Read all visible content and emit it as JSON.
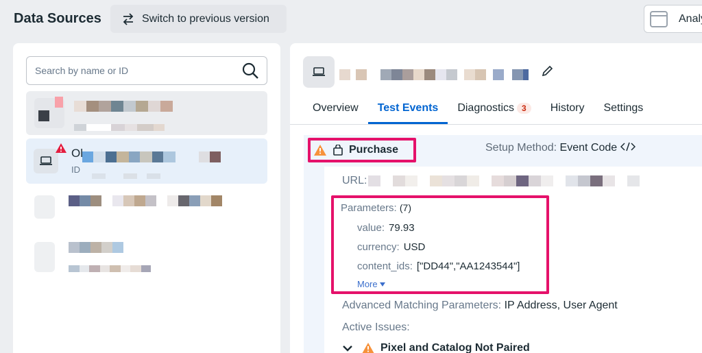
{
  "header": {
    "title": "Data Sources",
    "switch_label": "Switch to previous version",
    "analytics_label": "Analy"
  },
  "search": {
    "placeholder": "Search by name or ID"
  },
  "sources": {
    "selected_name_prefix": "Ol",
    "selected_id_prefix": "ID"
  },
  "detail": {
    "tabs": [
      {
        "label": "Overview"
      },
      {
        "label": "Test Events"
      },
      {
        "label": "Diagnostics",
        "count": "3"
      },
      {
        "label": "History"
      },
      {
        "label": "Settings"
      }
    ],
    "event": {
      "name": "Purchase",
      "setup_label": "Setup Method:",
      "setup_value": "Event Code",
      "url_label": "URL:",
      "params_label": "Parameters:",
      "params_count": "(7)",
      "params": [
        {
          "key": "value:",
          "val": "79.93"
        },
        {
          "key": "currency:",
          "val": "USD"
        },
        {
          "key": "content_ids:",
          "val": "[\"DD44\",\"AA1243544\"]"
        }
      ],
      "more_label": "More",
      "adv_label": "Advanced Matching Parameters:",
      "adv_value": "IP Address, User Agent",
      "issues_label": "Active Issues:",
      "issue_title": "Pixel and Catalog Not Paired"
    }
  },
  "colors": {
    "accent": "#0064d1",
    "highlight": "#e5116a",
    "warning": "#f7923b",
    "error": "#e41e3f"
  }
}
